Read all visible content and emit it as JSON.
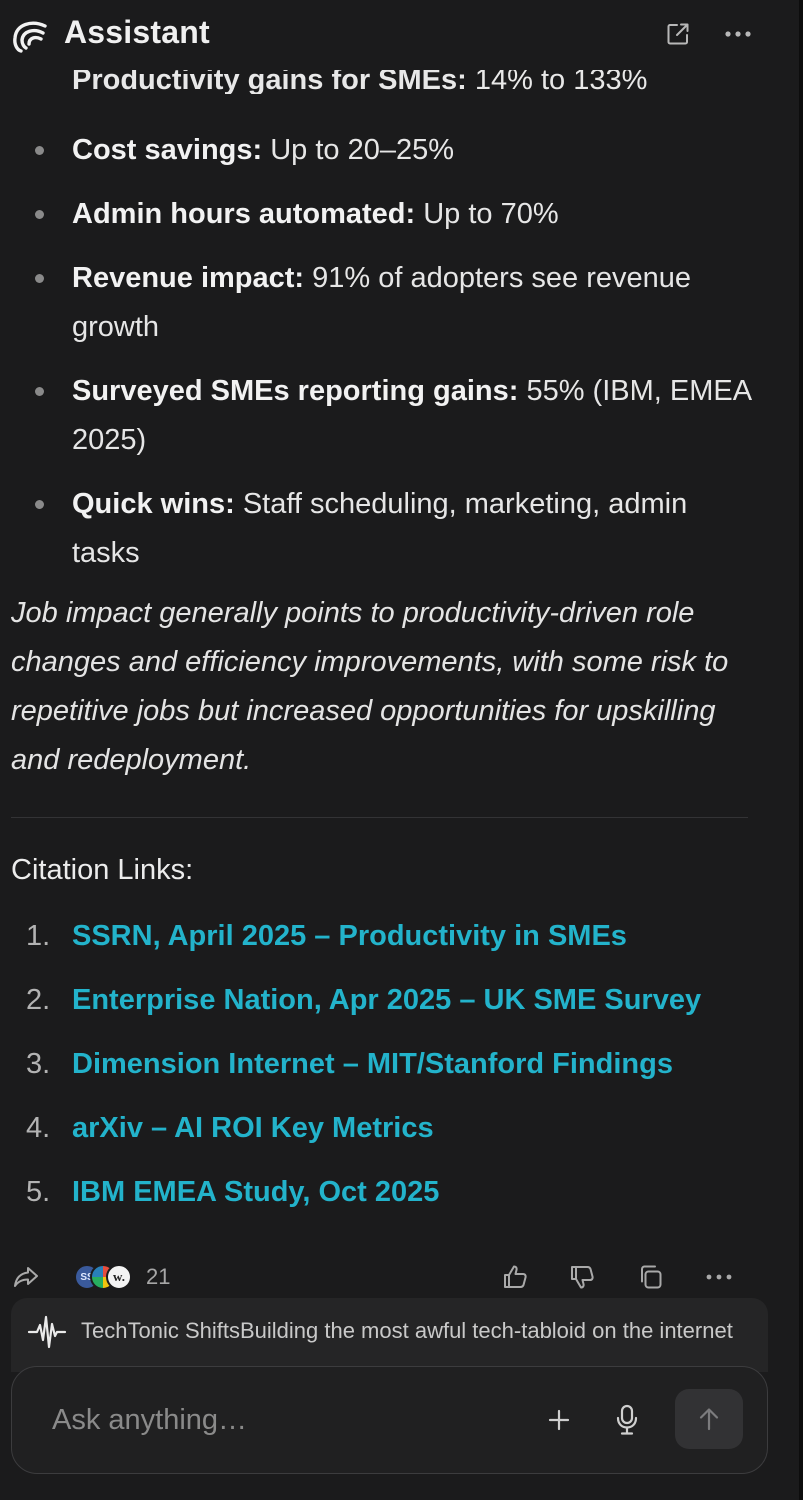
{
  "header": {
    "title": "Assistant",
    "logo_icon": "perplexity-logo-icon",
    "actions": [
      "open-external-icon",
      "more-horizontal-icon"
    ]
  },
  "content": {
    "partial_bullet": {
      "label": "Productivity gains for SMEs:",
      "value": " 14% to 133%"
    },
    "bullets": [
      {
        "label": "Cost savings:",
        "value": " Up to 20–25%"
      },
      {
        "label": "Admin hours automated:",
        "value": " Up to 70%"
      },
      {
        "label": "Revenue impact:",
        "value": " 91% of adopters see revenue growth"
      },
      {
        "label": "Surveyed SMEs reporting gains:",
        "value": " 55% (IBM, EMEA 2025)"
      },
      {
        "label": "Quick wins:",
        "value": " Staff scheduling, marketing, admin tasks"
      }
    ],
    "summary": "Job impact generally points to productivity-driven role changes and efficiency improvements, with some risk to repetitive jobs but increased opportunities for upskilling and redeployment.",
    "citations_heading": "Citation Links:",
    "citations": [
      {
        "num": "1.",
        "text": "SSRN, April 2025 – Productivity in SMEs"
      },
      {
        "num": "2.",
        "text": "Enterprise Nation, Apr 2025 – UK SME Survey"
      },
      {
        "num": "3.",
        "text": "Dimension Internet – MIT/Stanford Findings"
      },
      {
        "num": "4.",
        "text": "arXiv – AI ROI Key Metrics"
      },
      {
        "num": "5.",
        "text": "IBM EMEA Study, Oct 2025"
      }
    ]
  },
  "actions": {
    "sources_count": "21",
    "source_avatar_1": "SS",
    "source_avatar_3": "w.",
    "icons": [
      "share-icon",
      "thumbs-up-icon",
      "thumbs-down-icon",
      "copy-icon",
      "more-horizontal-icon"
    ]
  },
  "notification": {
    "text": "TechTonic ShiftsBuilding the most awful tech-tabloid on the internet",
    "icon": "waveform-icon"
  },
  "input": {
    "placeholder": "Ask anything…",
    "icons": [
      "plus-icon",
      "microphone-icon",
      "arrow-up-icon"
    ]
  },
  "colors": {
    "background": "#1b1b1c",
    "link": "#23b3cb",
    "text": "#e6e6e6",
    "muted": "#8a8a8a"
  }
}
